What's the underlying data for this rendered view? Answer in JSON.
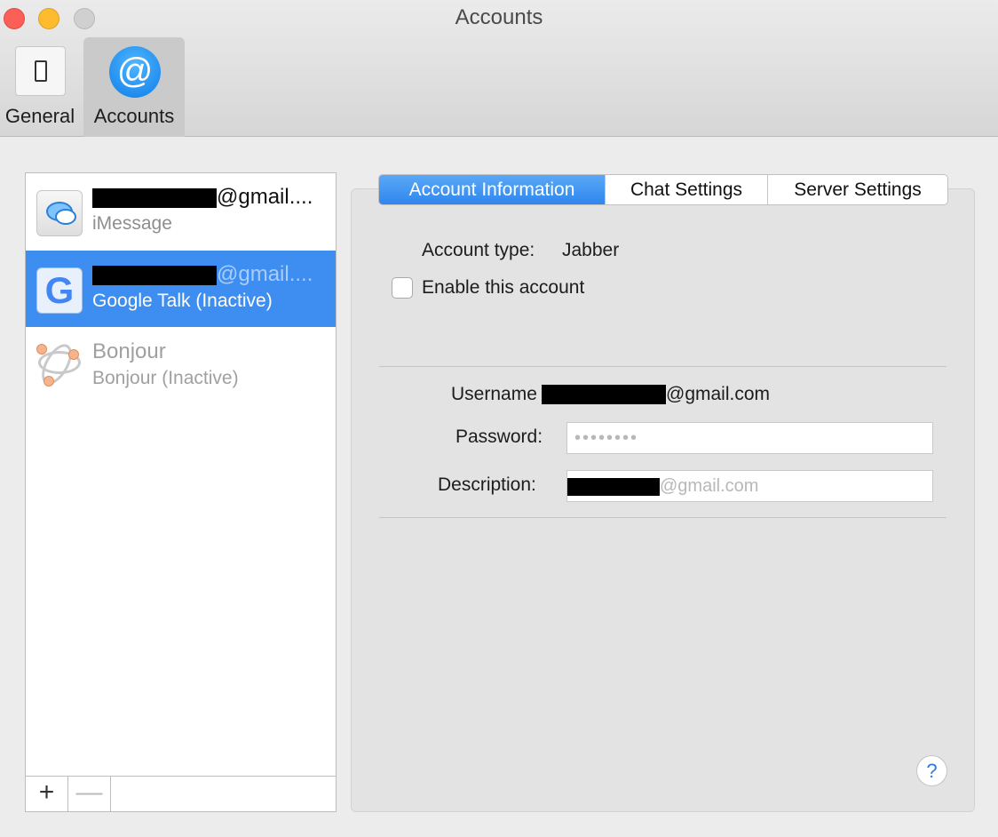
{
  "window": {
    "title": "Accounts"
  },
  "toolbar": {
    "general_label": "General",
    "accounts_label": "Accounts",
    "at_symbol": "@"
  },
  "accounts": [
    {
      "line1_suffix": "@gmail....",
      "line2": "iMessage"
    },
    {
      "line1_suffix": "@gmail....",
      "line2": "Google Talk (Inactive)"
    },
    {
      "line1": "Bonjour",
      "line2": "Bonjour (Inactive)"
    }
  ],
  "list_footer": {
    "add": "+",
    "remove": "—"
  },
  "tabs": [
    "Account Information",
    "Chat Settings",
    "Server Settings"
  ],
  "account_info": {
    "type_label": "Account type:",
    "type_value": "Jabber",
    "enable_label": "Enable this account",
    "username_label": "Username",
    "username_suffix": "@gmail.com",
    "password_label": "Password:",
    "password_value": "••••••••",
    "description_label": "Description:",
    "description_suffix": "@gmail.com"
  },
  "help": "?",
  "google_letter": "G",
  "colors": {
    "selection": "#3d8ef0",
    "tab_active": "#2f86ec"
  }
}
